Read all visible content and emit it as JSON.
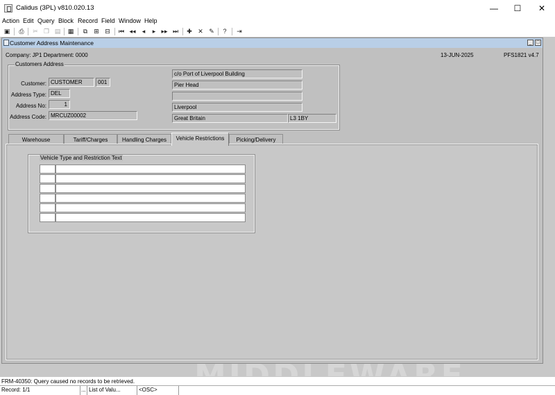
{
  "window": {
    "title": "Calidus (3PL) v810.020.13",
    "minimize": "—",
    "maximize": "☐",
    "close": "✕"
  },
  "menu": [
    "Action",
    "Edit",
    "Query",
    "Block",
    "Record",
    "Field",
    "Window",
    "Help"
  ],
  "toolbar_icons": [
    "save-icon",
    "print-icon",
    "cut-icon",
    "copy-icon",
    "paste-icon",
    "delete-icon",
    "duplicate-icon",
    "list-icon",
    "clear-icon",
    "first-record-icon",
    "prev-set-icon",
    "prev-record-icon",
    "next-record-icon",
    "next-set-icon",
    "last-record-icon",
    "insert-record-icon",
    "remove-record-icon",
    "lock-record-icon",
    "help-icon",
    "exit-icon"
  ],
  "form": {
    "title": "Customer Address Maintenance",
    "company_line": "Company:  JP1    Department:  0000",
    "date": "13-JUN-2025",
    "program": "PFS1821  v4.7"
  },
  "customers_address": {
    "legend": "Customers Address",
    "customer_label": "Customer:",
    "customer_type": "CUSTOMER",
    "customer_code": "001",
    "address_type_label": "Address Type:",
    "address_type": "DEL",
    "address_no_label": "Address No:",
    "address_no": "1",
    "address_code_label": "Address Code:",
    "address_code": "MRCUZ00002",
    "address_line1": "c/o Port of Liverpool Building",
    "address_line2": "Pier Head",
    "address_line3": "",
    "city": "Liverpool",
    "country": "Great Britain",
    "postcode": "L3 1BY"
  },
  "tabs": [
    {
      "label": "Warehouse",
      "active": false
    },
    {
      "label": "Tariff/Charges",
      "active": false
    },
    {
      "label": "Handling Charges",
      "active": false
    },
    {
      "label": "Vehicle  Restrictions",
      "active": true
    },
    {
      "label": "Picking/Delivery",
      "active": false
    }
  ],
  "vehicle_restrictions": {
    "legend": "Vehicle Type and Restriction Text",
    "rows": [
      {
        "type": "",
        "text": ""
      },
      {
        "type": "",
        "text": ""
      },
      {
        "type": "",
        "text": ""
      },
      {
        "type": "",
        "text": ""
      },
      {
        "type": "",
        "text": ""
      },
      {
        "type": "",
        "text": ""
      }
    ]
  },
  "background_watermark": "MIDDLEWARE",
  "message": "FRM-40350:  Query caused no records to be retrieved.",
  "statusbar": {
    "record": "Record: 1/1",
    "dots": "...",
    "list_of_values": "List of Valu...",
    "osc": "<OSC>"
  }
}
